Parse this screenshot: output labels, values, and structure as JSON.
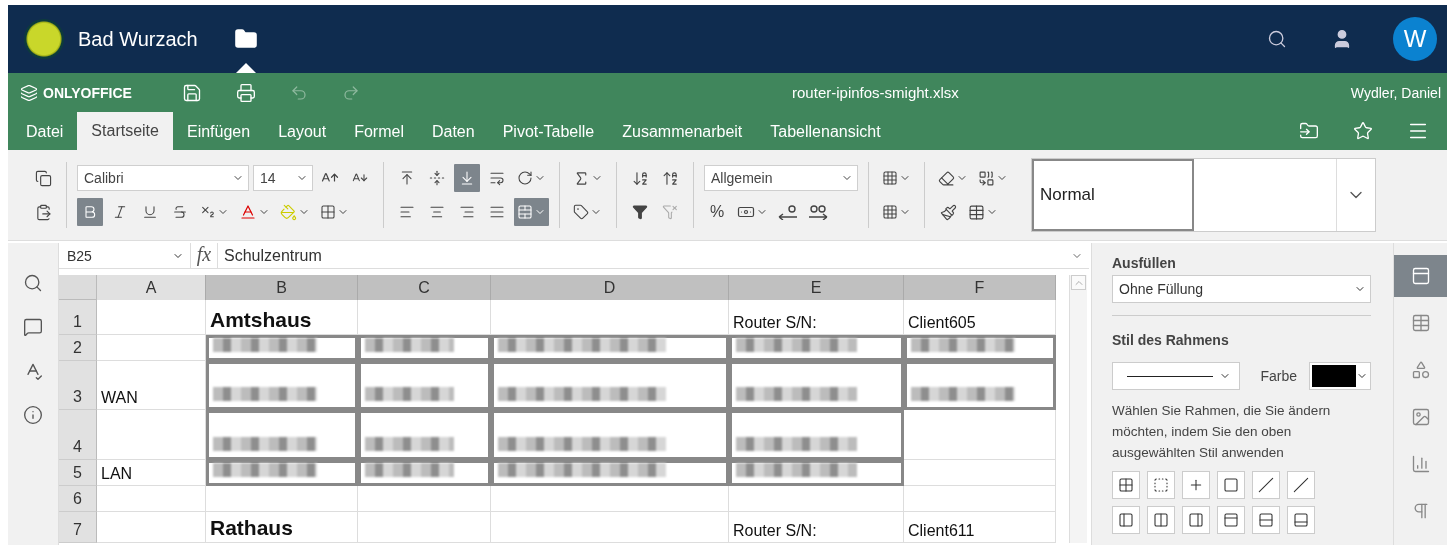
{
  "header": {
    "org": "Bad Wurzach",
    "avatar": "W"
  },
  "titlebar": {
    "brand": "ONLYOFFICE",
    "file": "router-ipinfos-smight.xlsx",
    "user": "Wydler, Daniel"
  },
  "tabs": [
    {
      "label": "Datei",
      "selected": false
    },
    {
      "label": "Startseite",
      "selected": true
    },
    {
      "label": "Einfügen",
      "selected": false
    },
    {
      "label": "Layout",
      "selected": false
    },
    {
      "label": "Formel",
      "selected": false
    },
    {
      "label": "Daten",
      "selected": false
    },
    {
      "label": "Pivot-Tabelle",
      "selected": false
    },
    {
      "label": "Zusammenarbeit",
      "selected": false
    },
    {
      "label": "Tabellenansicht",
      "selected": false
    }
  ],
  "toolbar": {
    "font": "Calibri",
    "size": "14",
    "number_format": "Allgemein",
    "style": "Normal",
    "percent": "%",
    "bold": true,
    "align_bottom": true,
    "merge": true
  },
  "formula_bar": {
    "cell": "B25",
    "fx": "fx",
    "value": "Schulzentrum"
  },
  "sheet": {
    "columns": [
      {
        "label": "A",
        "selected": false
      },
      {
        "label": "B",
        "selected": true
      },
      {
        "label": "C",
        "selected": true
      },
      {
        "label": "D",
        "selected": true
      },
      {
        "label": "E",
        "selected": true
      },
      {
        "label": "F",
        "selected": true
      }
    ],
    "rows": [
      {
        "number": "1",
        "cells": [
          {
            "kind": "empty"
          },
          {
            "kind": "heading",
            "text": "Amtshaus"
          },
          {
            "kind": "empty"
          },
          {
            "kind": "empty"
          },
          {
            "kind": "text",
            "text": "Router S/N:"
          },
          {
            "kind": "text",
            "text": "Client605"
          }
        ]
      },
      {
        "number": "2",
        "cells": [
          {
            "kind": "empty"
          },
          {
            "kind": "redacted"
          },
          {
            "kind": "redacted"
          },
          {
            "kind": "redacted"
          },
          {
            "kind": "redacted"
          },
          {
            "kind": "redacted"
          }
        ]
      },
      {
        "number": "3",
        "cells": [
          {
            "kind": "text",
            "text": "WAN"
          },
          {
            "kind": "redacted"
          },
          {
            "kind": "redacted"
          },
          {
            "kind": "redacted"
          },
          {
            "kind": "redacted"
          },
          {
            "kind": "redacted"
          }
        ]
      },
      {
        "number": "4",
        "cells": [
          {
            "kind": "empty"
          },
          {
            "kind": "redacted"
          },
          {
            "kind": "redacted"
          },
          {
            "kind": "redacted"
          },
          {
            "kind": "redacted"
          },
          {
            "kind": "empty"
          }
        ]
      },
      {
        "number": "5",
        "cells": [
          {
            "kind": "text",
            "text": "LAN"
          },
          {
            "kind": "redacted"
          },
          {
            "kind": "redacted"
          },
          {
            "kind": "redacted"
          },
          {
            "kind": "redacted"
          },
          {
            "kind": "empty"
          }
        ]
      },
      {
        "number": "6",
        "cells": [
          {
            "kind": "empty"
          },
          {
            "kind": "empty"
          },
          {
            "kind": "empty"
          },
          {
            "kind": "empty"
          },
          {
            "kind": "empty"
          },
          {
            "kind": "empty"
          }
        ]
      },
      {
        "number": "7",
        "cells": [
          {
            "kind": "empty"
          },
          {
            "kind": "heading",
            "text": "Rathaus"
          },
          {
            "kind": "empty"
          },
          {
            "kind": "empty"
          },
          {
            "kind": "text",
            "text": "Router S/N:"
          },
          {
            "kind": "text",
            "text": "Client611"
          }
        ]
      }
    ]
  },
  "panel": {
    "fill_title": "Ausfüllen",
    "fill": "Ohne Füllung",
    "border_title": "Stil des Rahmens",
    "color_label": "Farbe",
    "color": "#000000",
    "hint": "Wählen Sie Rahmen, die Sie ändern möchten, indem Sie den oben ausgewählten Stil anwenden"
  },
  "side_tabs": [
    {
      "kind": "cell",
      "selected": true
    },
    {
      "kind": "table",
      "selected": false
    },
    {
      "kind": "shape",
      "selected": false
    },
    {
      "kind": "image",
      "selected": false
    },
    {
      "kind": "chart",
      "selected": false
    },
    {
      "kind": "paragraph",
      "selected": false
    }
  ]
}
